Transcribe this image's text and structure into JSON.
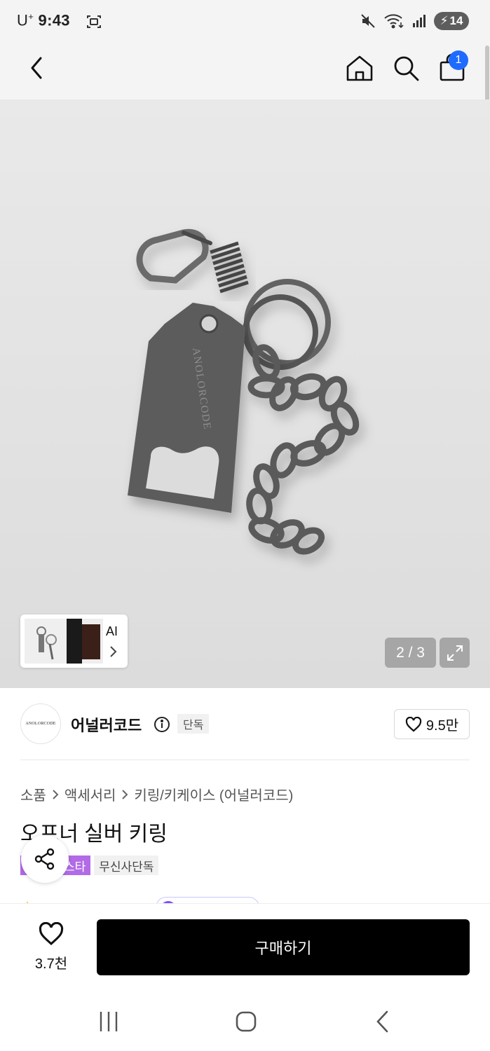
{
  "status_bar": {
    "carrier": "U",
    "carrier_sup": "+",
    "time": "9:43",
    "battery_level": "14"
  },
  "nav": {
    "cart_count": "1"
  },
  "gallery": {
    "ai_label": "AI",
    "page_indicator": "2 / 3",
    "engraving": "ANOLORCODE"
  },
  "brand": {
    "logo_text": "ANOLORCODE",
    "name": "어널러코드",
    "exclusive_tag": "단독",
    "likes": "9.5만"
  },
  "breadcrumb": {
    "items": [
      "소품",
      "액세서리",
      "키링/키케이스 (어널러코드)"
    ]
  },
  "product": {
    "title": "오프너 실버 키링",
    "tag_purple": "스타",
    "tag_gray": "무신사단독"
  },
  "bottom_bar": {
    "wish_count": "3.7천",
    "buy_label": "구매하기"
  },
  "colors": {
    "accent_blue": "#1f6bff",
    "tag_purple": "#b26be6",
    "buy_button": "#000000"
  }
}
